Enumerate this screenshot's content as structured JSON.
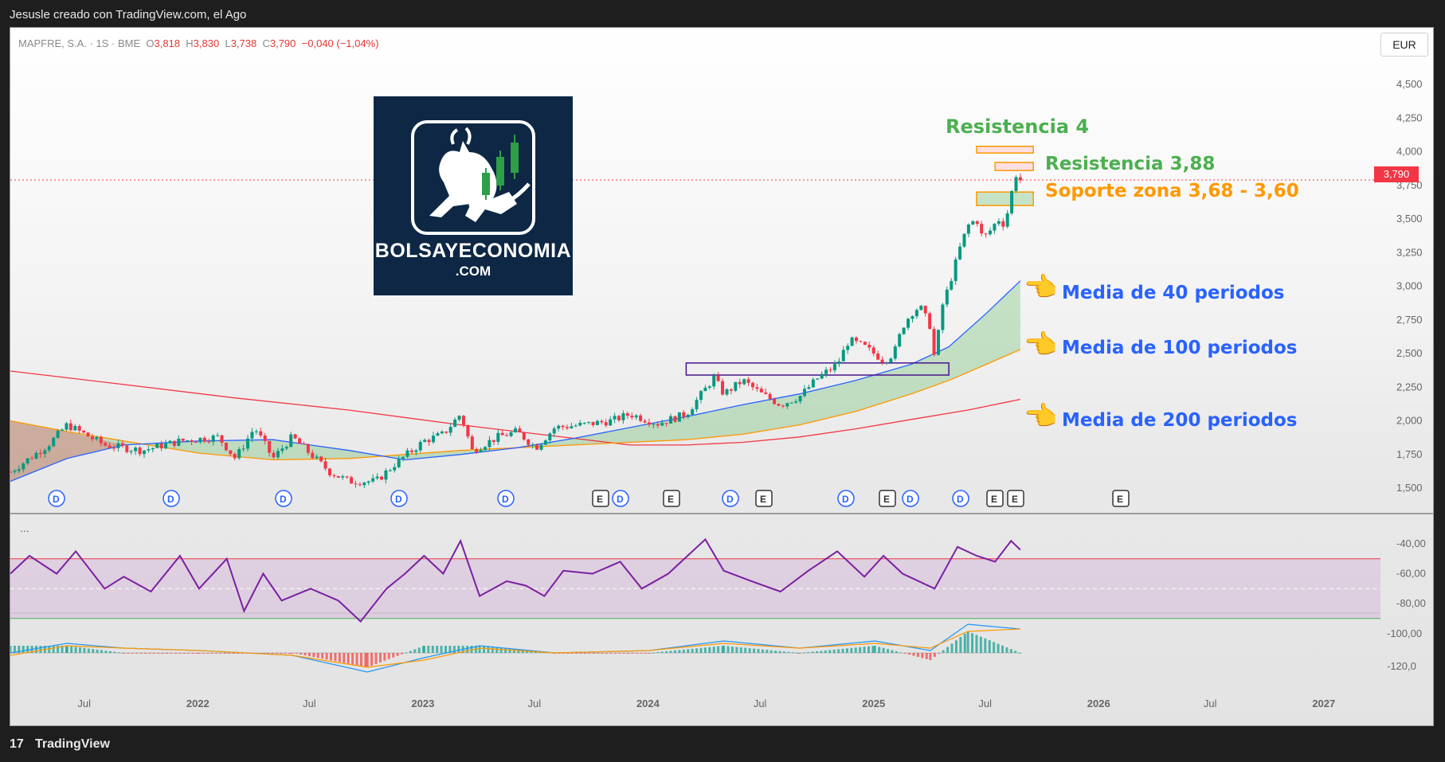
{
  "header": {
    "caption": "Jesusle creado con TradingView.com, el Ago"
  },
  "footer": {
    "logo_glyph": "17",
    "brand": "TradingView"
  },
  "legend": {
    "symbol": "MAPFRE, S.A. · 1S · BME",
    "open_label": "O",
    "open": "3,818",
    "high_label": "H",
    "high": "3,830",
    "low_label": "L",
    "low": "3,738",
    "close_label": "C",
    "close": "3,790",
    "change": "−0,040 (−1,04%)"
  },
  "currency": "EUR",
  "branding": {
    "name": "BOLSAYECONOMIA",
    "domain": ".COM"
  },
  "annotations": {
    "resistencia4": "Resistencia 4",
    "resistencia388": "Resistencia 3,88",
    "soporte": "Soporte zona 3,68 - 3,60",
    "media40": "Media de 40 periodos",
    "media100": "Media de 100 periodos",
    "media200": "Media de 200 periodos",
    "hand_icon": "👈"
  },
  "last_price_badge": "3,790",
  "more_glyph": "...",
  "colors": {
    "up": "#089981",
    "down": "#f23645",
    "ma40": "#2962ff",
    "ma100": "#ff9800",
    "ma200": "#f23645",
    "rsi": "#7b1fa2",
    "band": "#9c27b0",
    "green_text": "#4caf50",
    "orange_text": "#ff9800"
  },
  "chart_data": {
    "type": "candlestick",
    "symbol": "MAPFRE, S.A.",
    "interval": "1S",
    "exchange": "BME",
    "currency": "EUR",
    "ylim": [
      1.4,
      4.65
    ],
    "y_ticks": [
      "4,500",
      "4,250",
      "4,000",
      "3,750",
      "3,500",
      "3,250",
      "3,000",
      "2,750",
      "2,500",
      "2,250",
      "2,000",
      "1,750",
      "1,500"
    ],
    "y_tick_values": [
      4.5,
      4.25,
      4.0,
      3.75,
      3.5,
      3.25,
      3.0,
      2.75,
      2.5,
      2.25,
      2.0,
      1.75,
      1.5
    ],
    "x_ticks": [
      "Jul",
      "2022",
      "Jul",
      "2023",
      "Jul",
      "2024",
      "Jul",
      "2025",
      "Jul",
      "2026",
      "Jul",
      "2027"
    ],
    "x_tick_dates": [
      "2021-07-01",
      "2022-01-01",
      "2022-07-01",
      "2023-01-01",
      "2023-07-01",
      "2024-01-01",
      "2024-07-01",
      "2025-01-01",
      "2025-07-01",
      "2026-01-01",
      "2026-07-01",
      "2027-01-01"
    ],
    "x_range": [
      "2021-03-01",
      "2027-04-01"
    ],
    "price_path": [
      [
        "2021-03-01",
        1.62
      ],
      [
        "2021-05-01",
        1.82
      ],
      [
        "2021-06-01",
        1.97
      ],
      [
        "2021-08-01",
        1.82
      ],
      [
        "2021-10-01",
        1.78
      ],
      [
        "2021-12-01",
        1.85
      ],
      [
        "2022-02-01",
        1.88
      ],
      [
        "2022-03-01",
        1.72
      ],
      [
        "2022-04-01",
        1.95
      ],
      [
        "2022-05-01",
        1.72
      ],
      [
        "2022-06-01",
        1.88
      ],
      [
        "2022-08-01",
        1.62
      ],
      [
        "2022-09-01",
        1.55
      ],
      [
        "2022-10-15",
        1.55
      ],
      [
        "2022-11-15",
        1.68
      ],
      [
        "2023-01-01",
        1.85
      ],
      [
        "2023-02-01",
        1.9
      ],
      [
        "2023-03-01",
        2.05
      ],
      [
        "2023-03-20",
        1.78
      ],
      [
        "2023-05-01",
        1.88
      ],
      [
        "2023-06-01",
        1.92
      ],
      [
        "2023-07-01",
        1.8
      ],
      [
        "2023-08-01",
        1.95
      ],
      [
        "2023-09-15",
        1.97
      ],
      [
        "2023-11-01",
        2.0
      ],
      [
        "2023-12-01",
        2.05
      ],
      [
        "2024-01-15",
        1.98
      ],
      [
        "2024-03-01",
        2.05
      ],
      [
        "2024-04-15",
        2.32
      ],
      [
        "2024-05-01",
        2.2
      ],
      [
        "2024-06-01",
        2.3
      ],
      [
        "2024-07-01",
        2.2
      ],
      [
        "2024-08-01",
        2.12
      ],
      [
        "2024-09-01",
        2.18
      ],
      [
        "2024-10-01",
        2.32
      ],
      [
        "2024-11-01",
        2.42
      ],
      [
        "2024-11-20",
        2.6
      ],
      [
        "2024-12-15",
        2.55
      ],
      [
        "2025-01-15",
        2.45
      ],
      [
        "2025-02-01",
        2.5
      ],
      [
        "2025-02-15",
        2.7
      ],
      [
        "2025-03-01",
        2.8
      ],
      [
        "2025-03-15",
        2.85
      ],
      [
        "2025-04-01",
        2.7
      ],
      [
        "2025-04-08",
        2.45
      ],
      [
        "2025-04-20",
        2.85
      ],
      [
        "2025-05-01",
        3.0
      ],
      [
        "2025-05-20",
        3.3
      ],
      [
        "2025-06-01",
        3.45
      ],
      [
        "2025-06-15",
        3.5
      ],
      [
        "2025-06-25",
        3.35
      ],
      [
        "2025-07-05",
        3.4
      ],
      [
        "2025-07-20",
        3.5
      ],
      [
        "2025-08-01",
        3.45
      ],
      [
        "2025-08-05",
        3.58
      ],
      [
        "2025-08-12",
        3.72
      ],
      [
        "2025-08-18",
        3.83
      ],
      [
        "2025-08-25",
        3.79
      ]
    ],
    "last_candle": {
      "open": 3.818,
      "high": 3.83,
      "low": 3.738,
      "close": 3.79,
      "change": -0.04,
      "change_pct": -1.04
    },
    "moving_averages": [
      {
        "name": "Media de 40 periodos",
        "period": 40,
        "color": "#2962ff",
        "points": [
          [
            "2021-03-01",
            1.55
          ],
          [
            "2021-06-01",
            1.72
          ],
          [
            "2021-09-01",
            1.82
          ],
          [
            "2022-01-01",
            1.85
          ],
          [
            "2022-05-01",
            1.86
          ],
          [
            "2022-09-01",
            1.78
          ],
          [
            "2022-12-01",
            1.71
          ],
          [
            "2023-03-01",
            1.75
          ],
          [
            "2023-06-01",
            1.8
          ],
          [
            "2023-09-01",
            1.87
          ],
          [
            "2023-12-01",
            1.95
          ],
          [
            "2024-03-01",
            2.03
          ],
          [
            "2024-06-01",
            2.12
          ],
          [
            "2024-09-01",
            2.2
          ],
          [
            "2024-12-01",
            2.3
          ],
          [
            "2025-03-01",
            2.42
          ],
          [
            "2025-05-01",
            2.55
          ],
          [
            "2025-07-01",
            2.8
          ],
          [
            "2025-08-25",
            3.04
          ]
        ]
      },
      {
        "name": "Media de 100 periodos",
        "period": 100,
        "color": "#ff9800",
        "points": [
          [
            "2021-03-01",
            2.0
          ],
          [
            "2021-06-01",
            1.92
          ],
          [
            "2021-09-01",
            1.85
          ],
          [
            "2022-01-01",
            1.76
          ],
          [
            "2022-05-01",
            1.71
          ],
          [
            "2022-09-01",
            1.72
          ],
          [
            "2022-12-01",
            1.75
          ],
          [
            "2023-03-01",
            1.78
          ],
          [
            "2023-06-01",
            1.8
          ],
          [
            "2023-09-01",
            1.82
          ],
          [
            "2023-12-01",
            1.84
          ],
          [
            "2024-03-01",
            1.86
          ],
          [
            "2024-06-01",
            1.9
          ],
          [
            "2024-09-01",
            1.97
          ],
          [
            "2024-12-01",
            2.07
          ],
          [
            "2025-03-01",
            2.2
          ],
          [
            "2025-05-01",
            2.3
          ],
          [
            "2025-07-01",
            2.42
          ],
          [
            "2025-08-25",
            2.53
          ]
        ]
      },
      {
        "name": "Media de 200 periodos",
        "period": 200,
        "color": "#f23645",
        "points": [
          [
            "2021-03-01",
            2.37
          ],
          [
            "2021-09-01",
            2.27
          ],
          [
            "2022-03-01",
            2.17
          ],
          [
            "2022-09-01",
            2.08
          ],
          [
            "2023-03-01",
            1.97
          ],
          [
            "2023-09-01",
            1.87
          ],
          [
            "2023-12-01",
            1.82
          ],
          [
            "2024-03-01",
            1.82
          ],
          [
            "2024-06-01",
            1.84
          ],
          [
            "2024-09-01",
            1.88
          ],
          [
            "2024-12-01",
            1.94
          ],
          [
            "2025-03-01",
            2.01
          ],
          [
            "2025-06-01",
            2.08
          ],
          [
            "2025-08-25",
            2.16
          ]
        ]
      }
    ],
    "zones": [
      {
        "name": "Resistencia 4",
        "low": 3.99,
        "high": 4.04,
        "color": "#ff9800"
      },
      {
        "name": "Resistencia 3,88",
        "low": 3.86,
        "high": 3.92,
        "color": "#ff9800"
      },
      {
        "name": "Soporte zona 3,68 - 3,60",
        "low": 3.6,
        "high": 3.7,
        "color": "#ff9800"
      },
      {
        "name": "",
        "low": 2.34,
        "high": 2.43,
        "color": "#4a148c"
      }
    ],
    "events": [
      "D",
      "D",
      "D",
      "D",
      "D",
      "E",
      "D",
      "E",
      "D",
      "E",
      "D",
      "E",
      "D",
      "D",
      "E",
      "E",
      "E"
    ],
    "rsi": {
      "y_ticks": [
        "-40,00",
        "-60,00",
        "-80,00"
      ],
      "y_tick_values": [
        -40,
        -60,
        -80
      ],
      "band": [
        -50,
        -90
      ],
      "midline": -70,
      "points": [
        [
          "2021-03-01",
          -60
        ],
        [
          "2021-04-01",
          -48
        ],
        [
          "2021-05-15",
          -60
        ],
        [
          "2021-06-15",
          -45
        ],
        [
          "2021-08-01",
          -70
        ],
        [
          "2021-09-01",
          -62
        ],
        [
          "2021-10-15",
          -72
        ],
        [
          "2021-12-01",
          -48
        ],
        [
          "2022-01-01",
          -70
        ],
        [
          "2022-02-15",
          -50
        ],
        [
          "2022-03-15",
          -85
        ],
        [
          "2022-04-15",
          -60
        ],
        [
          "2022-05-15",
          -78
        ],
        [
          "2022-07-01",
          -70
        ],
        [
          "2022-08-15",
          -78
        ],
        [
          "2022-09-20",
          -92
        ],
        [
          "2022-11-01",
          -70
        ],
        [
          "2022-12-01",
          -60
        ],
        [
          "2023-01-01",
          -48
        ],
        [
          "2023-02-01",
          -60
        ],
        [
          "2023-03-01",
          -38
        ],
        [
          "2023-04-01",
          -75
        ],
        [
          "2023-05-15",
          -65
        ],
        [
          "2023-06-15",
          -68
        ],
        [
          "2023-07-15",
          -75
        ],
        [
          "2023-08-15",
          -58
        ],
        [
          "2023-10-01",
          -60
        ],
        [
          "2023-11-15",
          -52
        ],
        [
          "2023-12-20",
          -70
        ],
        [
          "2024-02-01",
          -60
        ],
        [
          "2024-04-01",
          -37
        ],
        [
          "2024-05-01",
          -58
        ],
        [
          "2024-06-15",
          -65
        ],
        [
          "2024-08-01",
          -72
        ],
        [
          "2024-09-15",
          -58
        ],
        [
          "2024-11-01",
          -45
        ],
        [
          "2024-12-15",
          -62
        ],
        [
          "2025-01-15",
          -48
        ],
        [
          "2025-02-15",
          -60
        ],
        [
          "2025-04-08",
          -70
        ],
        [
          "2025-05-15",
          -42
        ],
        [
          "2025-06-15",
          -48
        ],
        [
          "2025-07-15",
          -52
        ],
        [
          "2025-08-10",
          -38
        ],
        [
          "2025-08-25",
          -44
        ]
      ]
    },
    "macd": {
      "y_ticks": [
        "-100,00",
        "-120,0"
      ],
      "y_tick_values": [
        -100,
        -120
      ],
      "macd_line": [
        [
          "2021-03-01",
          0.0
        ],
        [
          "2021-06-01",
          0.04
        ],
        [
          "2021-09-01",
          0.02
        ],
        [
          "2022-01-01",
          0.01
        ],
        [
          "2022-06-01",
          -0.01
        ],
        [
          "2022-10-01",
          -0.08
        ],
        [
          "2023-01-01",
          -0.02
        ],
        [
          "2023-04-01",
          0.03
        ],
        [
          "2023-08-01",
          0.0
        ],
        [
          "2024-01-01",
          0.01
        ],
        [
          "2024-05-01",
          0.05
        ],
        [
          "2024-09-01",
          0.02
        ],
        [
          "2025-01-01",
          0.05
        ],
        [
          "2025-04-01",
          0.01
        ],
        [
          "2025-06-01",
          0.12
        ],
        [
          "2025-08-25",
          0.1
        ]
      ],
      "signal_line": [
        [
          "2021-03-01",
          -0.01
        ],
        [
          "2021-06-01",
          0.03
        ],
        [
          "2021-09-01",
          0.02
        ],
        [
          "2022-01-01",
          0.01
        ],
        [
          "2022-06-01",
          -0.01
        ],
        [
          "2022-10-01",
          -0.06
        ],
        [
          "2023-01-01",
          -0.03
        ],
        [
          "2023-04-01",
          0.02
        ],
        [
          "2023-08-01",
          0.0
        ],
        [
          "2024-01-01",
          0.01
        ],
        [
          "2024-05-01",
          0.04
        ],
        [
          "2024-09-01",
          0.02
        ],
        [
          "2025-01-01",
          0.04
        ],
        [
          "2025-04-01",
          0.02
        ],
        [
          "2025-06-01",
          0.09
        ],
        [
          "2025-08-25",
          0.1
        ]
      ]
    }
  }
}
